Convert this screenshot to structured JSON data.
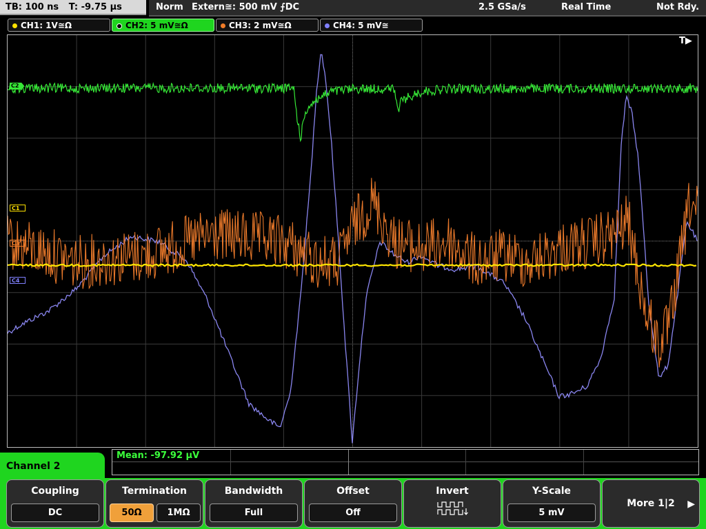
{
  "status_bar": {
    "timebase": "TB: 100 ns",
    "trigger_time": "T: -9.75 µs",
    "trigger_mode": "Norm",
    "trigger_source": "Extern≅: 500 mV ⨍DC",
    "sample_rate": "2.5 GSa/s",
    "acq_mode": "Real Time",
    "ready_state": "Not Rdy."
  },
  "channels": [
    {
      "label": "CH1: 1V≅Ω",
      "color": "#ffe100"
    },
    {
      "label": "CH2: 5 mV≅Ω",
      "color": "#3bff3b",
      "active": true
    },
    {
      "label": "CH3: 2 mV≅Ω",
      "color": "#f07c28"
    },
    {
      "label": "CH4: 5 mV≅",
      "color": "#8080ff"
    }
  ],
  "scope": {
    "trigger_marker": "T▶",
    "ch_markers": [
      "C2",
      "C1",
      "C3",
      "C4"
    ]
  },
  "measurement": {
    "mean": "Mean: -97.92 µV"
  },
  "channel_panel": {
    "title": "Channel 2"
  },
  "softkeys": {
    "coupling": {
      "title": "Coupling",
      "value": "DC"
    },
    "termination": {
      "title": "Termination",
      "opt1": "50Ω",
      "opt2": "1MΩ"
    },
    "bandwidth": {
      "title": "Bandwidth",
      "value": "Full"
    },
    "offset": {
      "title": "Offset",
      "value": "Off"
    },
    "invert": {
      "title": "Invert"
    },
    "yscale": {
      "title": "Y-Scale",
      "value": "5 mV"
    },
    "more": {
      "label": "More 1|2"
    }
  }
}
